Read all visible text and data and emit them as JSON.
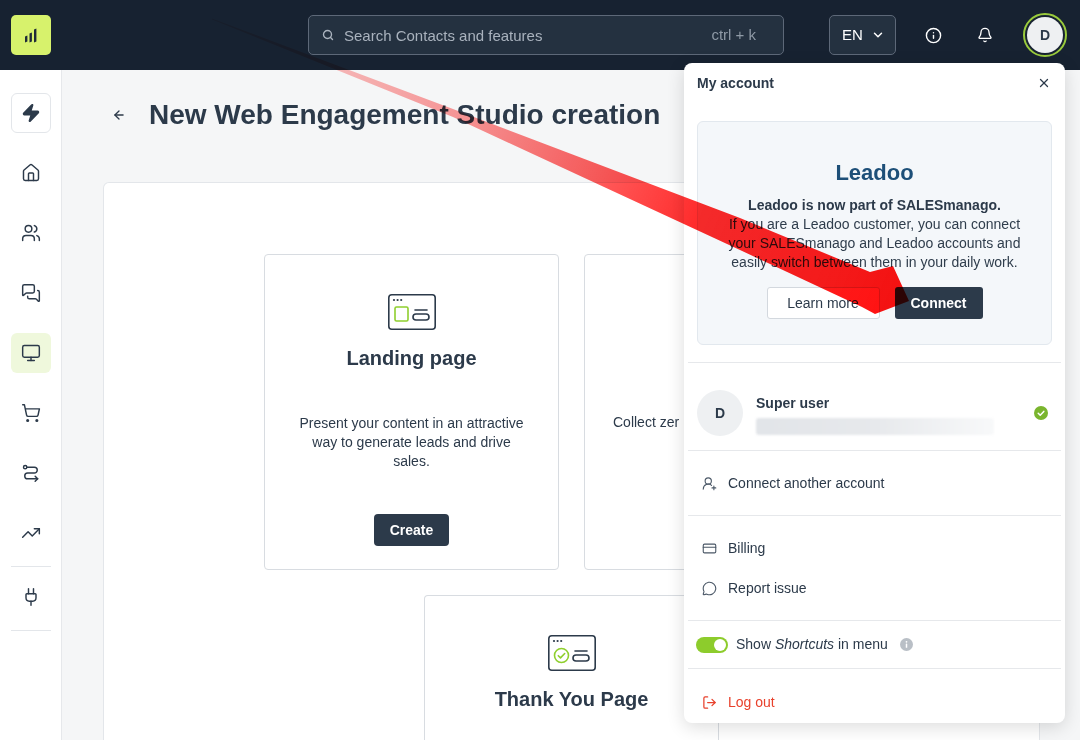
{
  "top_bar": {
    "search": {
      "placeholder": "Search Contacts and features",
      "shortcut": "ctrl + k"
    },
    "language": "EN",
    "avatar": "D"
  },
  "sidebar": {
    "groups": [
      [
        {
          "kind": "pinned",
          "selected": false
        },
        {
          "kind": "nav",
          "selected": false
        },
        {
          "kind": "nav",
          "selected": false
        },
        {
          "kind": "nav",
          "selected": false
        },
        {
          "kind": "nav",
          "selected": true
        },
        {
          "kind": "nav",
          "selected": false
        },
        {
          "kind": "nav",
          "selected": false
        },
        {
          "kind": "nav",
          "selected": false
        }
      ],
      [
        {
          "kind": "nav",
          "selected": false
        }
      ]
    ]
  },
  "page": {
    "title": "New Web Engagement Studio creation"
  },
  "card_rows": [
    [
      {
        "kind": "landing",
        "title": "Landing page",
        "description": "Present your content in an attractive way to generate leads and drive sales.",
        "button": "Create"
      },
      {
        "kind": "covered",
        "description": "Collect zer"
      }
    ],
    [
      {
        "kind": "thanks",
        "title": "Thank You Page"
      }
    ]
  ],
  "account_menu": {
    "title": "My account",
    "promo": {
      "logo": "Leadoo",
      "headline": "Leadoo is now part of SALESmanago.",
      "body": "If you are a Leadoo customer, you can connect your SALESmanago and Leadoo accounts and easily switch between them in your daily work.",
      "buttons": [
        {
          "kind": "secondary",
          "label": "Learn more"
        },
        {
          "kind": "primary",
          "label": "Connect"
        }
      ]
    },
    "account": {
      "avatar": "D",
      "name": "Super user",
      "active": true
    },
    "sections": [
      [
        {
          "label": "Connect another account"
        }
      ],
      [
        {
          "label": "Billing"
        },
        {
          "label": "Report issue"
        }
      ]
    ],
    "shortcuts_toggle": {
      "label": "Show *Shortcuts* in menu",
      "on": true
    },
    "logout": {
      "label": "Log out"
    }
  }
}
